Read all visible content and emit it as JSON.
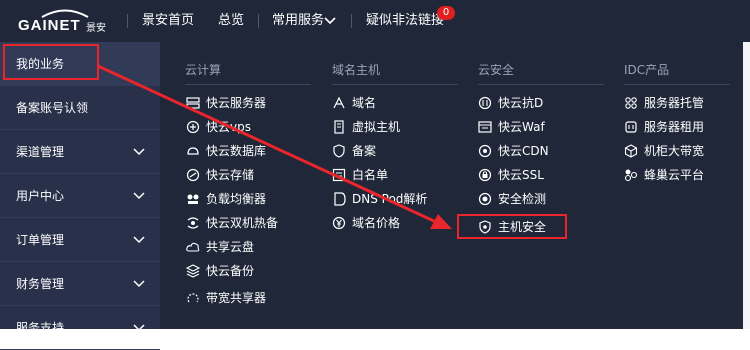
{
  "header": {
    "logo_text": "GAINET",
    "logo_cn": "景安",
    "nav": [
      {
        "label": "景安首页"
      },
      {
        "label": "总览"
      },
      {
        "label": "常用服务"
      },
      {
        "label": "疑似非法链接"
      }
    ],
    "badge_count": "0"
  },
  "sidebar": {
    "items": [
      {
        "label": "我的业务"
      },
      {
        "label": "备案账号认领"
      },
      {
        "label": "渠道管理"
      },
      {
        "label": "用户中心"
      },
      {
        "label": "订单管理"
      },
      {
        "label": "财务管理"
      },
      {
        "label": "服务支持"
      }
    ]
  },
  "menu": {
    "columns": [
      {
        "title": "云计算",
        "items": [
          {
            "label": "快云服务器",
            "icon": "server-icon"
          },
          {
            "label": "快云vps",
            "icon": "vps-icon"
          },
          {
            "label": "快云数据库",
            "icon": "database-icon"
          },
          {
            "label": "快云存储",
            "icon": "storage-icon"
          },
          {
            "label": "负载均衡器",
            "icon": "load-balancer-icon"
          },
          {
            "label": "快云双机热备",
            "icon": "hot-backup-icon"
          },
          {
            "label": "共享云盘",
            "icon": "cloud-disk-icon"
          },
          {
            "label": "快云备份",
            "icon": "backup-icon"
          },
          {
            "label": "带宽共享器",
            "icon": "bandwidth-icon"
          }
        ]
      },
      {
        "title": "域名主机",
        "items": [
          {
            "label": "域名",
            "icon": "domain-icon"
          },
          {
            "label": "虚拟主机",
            "icon": "virtual-host-icon"
          },
          {
            "label": "备案",
            "icon": "filing-icon"
          },
          {
            "label": "白名单",
            "icon": "whitelist-icon"
          },
          {
            "label": "DNS Pod解析",
            "icon": "dns-icon"
          },
          {
            "label": "域名价格",
            "icon": "price-icon"
          }
        ]
      },
      {
        "title": "云安全",
        "items": [
          {
            "label": "快云抗D",
            "icon": "anti-ddos-icon"
          },
          {
            "label": "快云Waf",
            "icon": "waf-icon"
          },
          {
            "label": "快云CDN",
            "icon": "cdn-icon"
          },
          {
            "label": "快云SSL",
            "icon": "ssl-icon"
          },
          {
            "label": "安全检测",
            "icon": "security-scan-icon"
          },
          {
            "label": "主机安全",
            "icon": "host-security-icon"
          }
        ]
      },
      {
        "title": "IDC产品",
        "items": [
          {
            "label": "服务器托管",
            "icon": "hosting-icon"
          },
          {
            "label": "服务器租用",
            "icon": "rental-icon"
          },
          {
            "label": "机柜大带宽",
            "icon": "cabinet-icon"
          },
          {
            "label": "蜂巢云平台",
            "icon": "hive-icon"
          }
        ]
      }
    ]
  },
  "colors": {
    "topbar": "#1f2739",
    "sidebar": "#28304a",
    "panel": "#1f2739",
    "highlight": "#e8262b",
    "badge": "#e02020"
  }
}
